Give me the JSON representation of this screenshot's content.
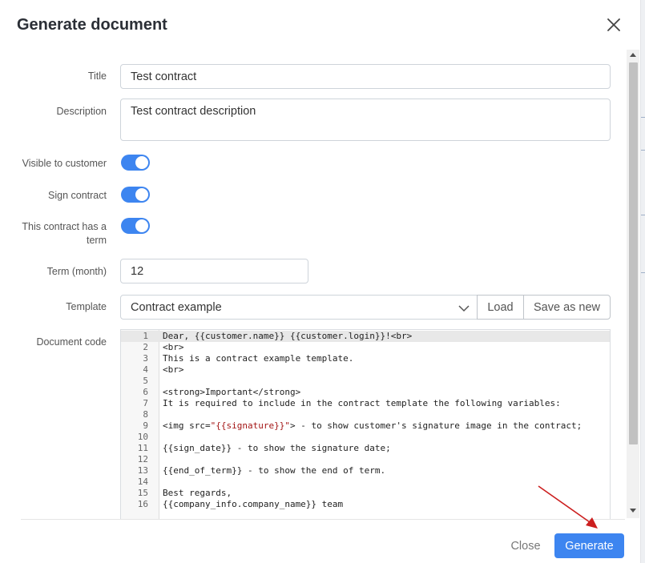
{
  "modal": {
    "title": "Generate document"
  },
  "form": {
    "title_label": "Title",
    "title_value": "Test contract",
    "description_label": "Description",
    "description_value": "Test contract description",
    "visible_label": "Visible to customer",
    "sign_label": "Sign contract",
    "term_toggle_label": "This contract has a term",
    "term_label": "Term (month)",
    "term_value": "12",
    "template_label": "Template",
    "template_value": "Contract example",
    "load_label": "Load",
    "save_as_new_label": "Save as new",
    "code_label": "Document code"
  },
  "toggles": {
    "visible_to_customer": true,
    "sign_contract": true,
    "has_term": true
  },
  "code_lines": [
    {
      "n": "1",
      "text": "Dear, {{customer.name}} {{customer.login}}!<br>"
    },
    {
      "n": "2",
      "text": "<br>"
    },
    {
      "n": "3",
      "text": "This is a contract example template."
    },
    {
      "n": "4",
      "text": "<br>"
    },
    {
      "n": "5",
      "text": ""
    },
    {
      "n": "6",
      "text": "<strong>Important</strong>"
    },
    {
      "n": "7",
      "text": "It is required to include in the contract template the following variables:"
    },
    {
      "n": "8",
      "text": ""
    },
    {
      "n": "9",
      "pre": "<img src=",
      "str": "\"{{signature}}\"",
      "post": "> - to show customer's signature image in the contract;"
    },
    {
      "n": "10",
      "text": ""
    },
    {
      "n": "11",
      "text": "{{sign_date}} - to show the signature date;"
    },
    {
      "n": "12",
      "text": ""
    },
    {
      "n": "13",
      "text": "{{end_of_term}} - to show the end of term."
    },
    {
      "n": "14",
      "text": ""
    },
    {
      "n": "15",
      "text": "Best regards,"
    },
    {
      "n": "16",
      "text": "{{company_info.company_name}} team"
    }
  ],
  "footer": {
    "close_label": "Close",
    "generate_label": "Generate"
  },
  "colors": {
    "primary": "#3d85f0",
    "annotation_arrow": "#cc1f1f"
  }
}
